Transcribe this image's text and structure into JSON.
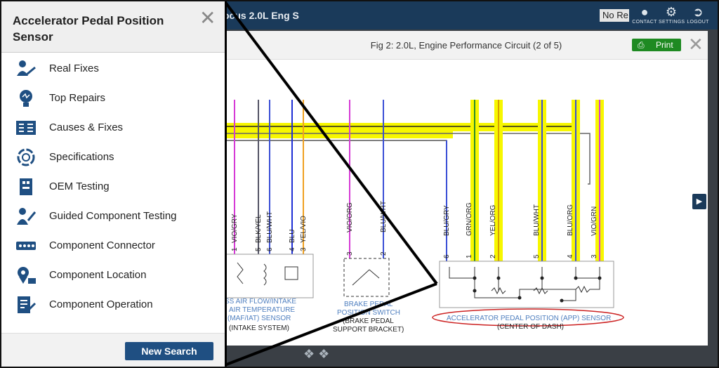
{
  "header": {
    "vehicle": "ocus 2.0L Eng S",
    "search_stub": "No Re",
    "icons": [
      {
        "name": "contact-icon",
        "label": "CONTACT"
      },
      {
        "name": "settings-icon",
        "label": "SETTINGS"
      },
      {
        "name": "logout-icon",
        "label": "LOGOUT"
      }
    ]
  },
  "panel": {
    "title": "Accelerator Pedal Position Sensor",
    "items": [
      {
        "label": "Real Fixes",
        "icon": "real-fixes-icon"
      },
      {
        "label": "Top Repairs",
        "icon": "top-repairs-icon"
      },
      {
        "label": "Causes & Fixes",
        "icon": "causes-fixes-icon"
      },
      {
        "label": "Specifications",
        "icon": "specifications-icon"
      },
      {
        "label": "OEM Testing",
        "icon": "oem-testing-icon"
      },
      {
        "label": "Guided Component Testing",
        "icon": "guided-testing-icon"
      },
      {
        "label": "Component Connector",
        "icon": "connector-icon"
      },
      {
        "label": "Component Location",
        "icon": "location-icon"
      },
      {
        "label": "Component Operation",
        "icon": "operation-icon"
      }
    ],
    "new_search": "New Search"
  },
  "modal": {
    "title": "Fig 2: 2.0L, Engine Performance Circuit (2 of 5)",
    "print": "Print"
  },
  "diagram": {
    "maf": {
      "wires": [
        {
          "pin": "1",
          "color": "VIO/GRY"
        },
        {
          "pin": "5",
          "color": "BLK/YEL"
        },
        {
          "pin": "6",
          "color": "BLU/WHT"
        },
        {
          "pin": "4",
          "color": "BLU"
        },
        {
          "pin": "3",
          "color": "YEL/VIO"
        }
      ],
      "label_lines": [
        "SS AIR FLOW/INTAKE",
        "AIR TEMPERATURE",
        "(MAF/IAT) SENSOR"
      ],
      "sublabel": "(INTAKE SYSTEM)"
    },
    "brake": {
      "wires": [
        {
          "pin": "3",
          "color": "VIO/ORG"
        },
        {
          "pin": "2",
          "color": "BLU/WHT"
        }
      ],
      "label_lines": [
        "BRAKE PEDAL",
        "POSITION SWITCH"
      ],
      "sublabel_lines": [
        "(BRAKE PEDAL",
        "SUPPORT BRACKET)"
      ]
    },
    "app": {
      "wires": [
        {
          "pin": "6",
          "color": "BLU/GRY"
        },
        {
          "pin": "1",
          "color": "GRN/ORG"
        },
        {
          "pin": "2",
          "color": "YEL/ORG"
        },
        {
          "pin": "5",
          "color": "BLU/WHT"
        },
        {
          "pin": "4",
          "color": "BLU/ORG"
        },
        {
          "pin": "3",
          "color": "VIO/GRN"
        }
      ],
      "label": "ACCELERATOR PEDAL POSITION (APP) SENSOR",
      "sublabel": "(CENTER OF DASH)"
    }
  },
  "colors": {
    "highlight": "#f7f700",
    "header_bg": "#1a3a5a",
    "button_blue": "#1f4f82",
    "print_green": "#1e8a22",
    "sensor_label": "#4f7fbf",
    "callout_ring": "#cc2222"
  }
}
